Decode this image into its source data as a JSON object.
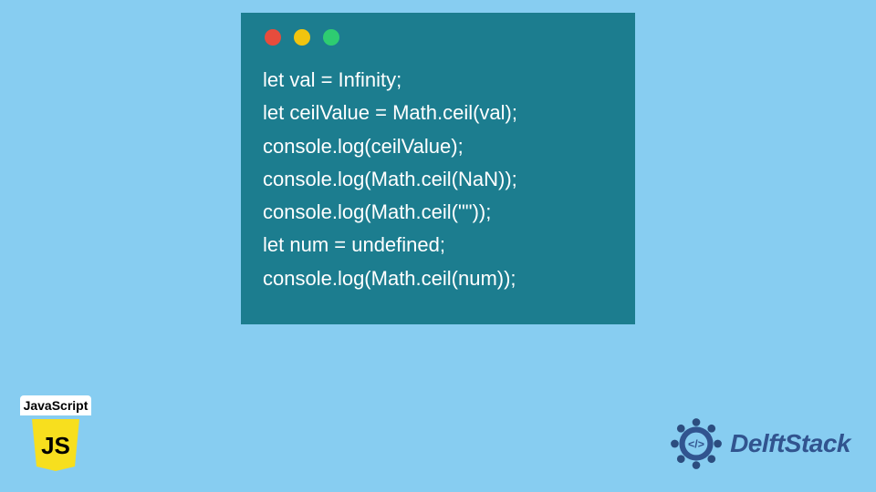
{
  "code": {
    "lines": [
      "let val = Infinity;",
      "let ceilValue = Math.ceil(val);",
      "console.log(ceilValue);",
      "console.log(Math.ceil(NaN));",
      "console.log(Math.ceil(\"\"));",
      "let num = undefined;",
      "console.log(Math.ceil(num));"
    ]
  },
  "js_badge": {
    "label": "JavaScript",
    "logo_text": "JS"
  },
  "delft": {
    "text": "DelftStack"
  },
  "colors": {
    "page_bg": "#87cdf1",
    "card_bg": "#1c7d8f",
    "delft_primary": "#31548f",
    "js_logo_bg": "#f7df1e"
  }
}
